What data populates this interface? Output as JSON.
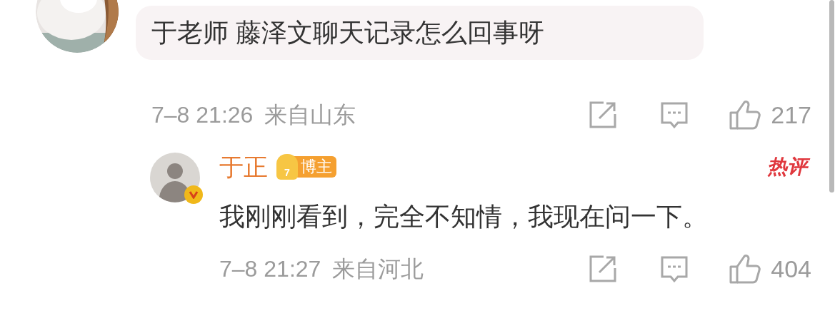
{
  "comments": [
    {
      "kind": "main",
      "verified": false,
      "text": "于老师 藤泽文聊天记录怎么回事呀",
      "time": "7–8 21:26",
      "location": "来自山东",
      "likes": "217"
    },
    {
      "kind": "reply",
      "verified": true,
      "author": "于正",
      "badge_level": "7",
      "badge": "博主",
      "hot_label": "热评",
      "text": "我刚刚看到，完全不知情，我现在问一下。",
      "time": "7–8 21:27",
      "location": "来自河北",
      "likes": "404"
    }
  ]
}
